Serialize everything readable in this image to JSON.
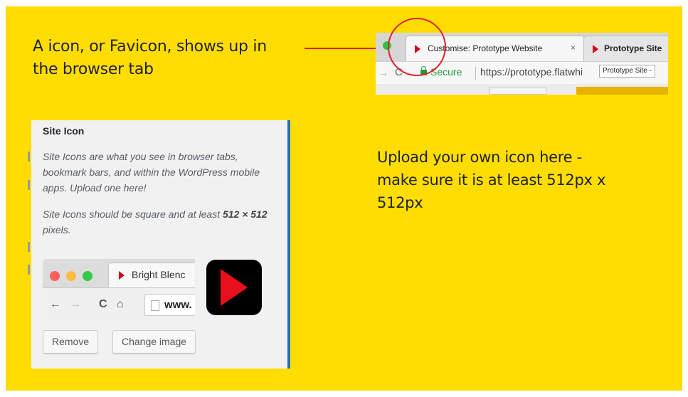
{
  "callouts": {
    "top_line1": "A icon, or Favicon, shows up in",
    "top_line2": "the browser tab",
    "right_line1": "Upload your own icon here -",
    "right_line2": "make sure it is at least 512px x",
    "right_line3": "512px"
  },
  "browser_example": {
    "active_tab_title": "Customise: Prototype Website",
    "active_tab_close": "×",
    "second_tab_title": "Prototype Site",
    "secure_label": "Secure",
    "url": "https://prototype.flatwhi",
    "tooltip": "Prototype Site -",
    "favicon_icon": "play-triangle-icon",
    "favicon_color": "#d0021b"
  },
  "site_icon_panel": {
    "heading": "Site Icon",
    "description_1": "Site Icons are what you see in browser tabs, bookmark bars, and within the WordPress mobile apps. Upload one here!",
    "description_2_prefix": "Site Icons should be square and at least ",
    "description_2_bold": "512 × 512",
    "description_2_suffix": " pixels.",
    "preview_tab_title": "Bright Blenc",
    "preview_url": "www.",
    "remove_button": "Remove",
    "change_button": "Change image",
    "icon_colors": {
      "background": "#000000",
      "triangle": "#e8101d"
    }
  },
  "colors": {
    "slide_background": "#FFDD00",
    "highlight_red": "#e2202a"
  }
}
